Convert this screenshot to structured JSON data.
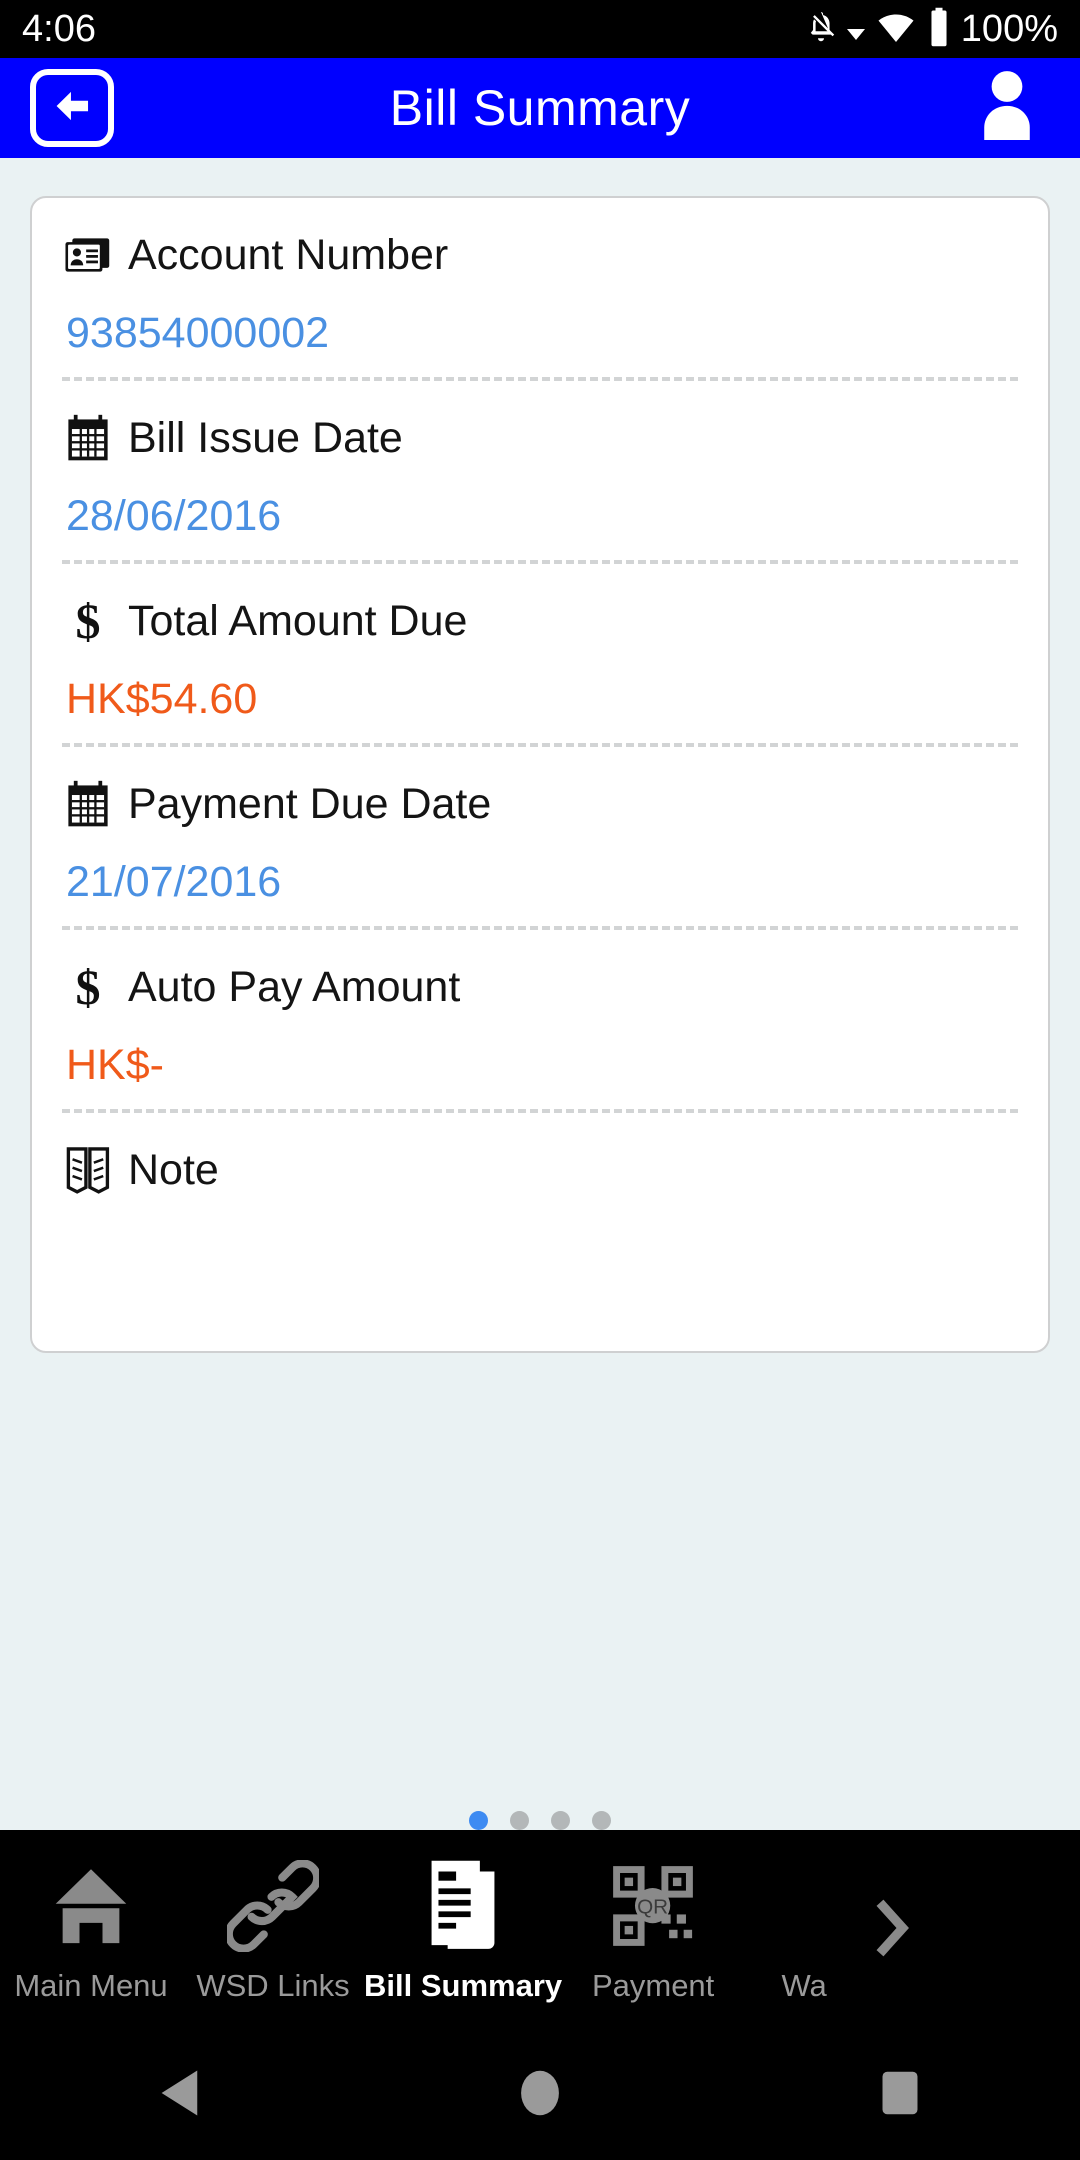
{
  "status_bar": {
    "time": "4:06",
    "battery_percent": "100%",
    "icons": [
      "notifications-off-icon",
      "caret-down-icon",
      "wifi-icon",
      "battery-icon"
    ]
  },
  "app_bar": {
    "title": "Bill Summary",
    "back_icon": "back-arrow-icon",
    "profile_icon": "person-icon"
  },
  "card": {
    "rows": [
      {
        "icon": "id-card-icon",
        "label": "Account Number",
        "value": "93854000002",
        "value_color": "#4a90e2"
      },
      {
        "icon": "calendar-icon",
        "label": "Bill Issue Date",
        "value": "28/06/2016",
        "value_color": "#4a90e2"
      },
      {
        "icon": "dollar-icon",
        "label": "Total Amount Due",
        "value": "HK$54.60",
        "value_color": "#f05a1a"
      },
      {
        "icon": "calendar-icon",
        "label": "Payment Due Date",
        "value": "21/07/2016",
        "value_color": "#4a90e2"
      },
      {
        "icon": "dollar-icon",
        "label": "Auto Pay Amount",
        "value": "HK$-",
        "value_color": "#f05a1a"
      },
      {
        "icon": "book-icon",
        "label": "Note",
        "value": "",
        "value_color": ""
      }
    ]
  },
  "pager": {
    "total_dots": 4,
    "active_index": 0
  },
  "tab_bar": {
    "active_index": 2,
    "tabs": [
      {
        "label": "Main Menu",
        "icon": "home-icon"
      },
      {
        "label": "WSD Links",
        "icon": "link-icon"
      },
      {
        "label": "Bill Summary",
        "icon": "document-icon"
      },
      {
        "label": "Payment",
        "icon": "qr-code-icon"
      },
      {
        "label": "Wa",
        "icon": "partial-icon"
      }
    ],
    "next_arrow_icon": "chevron-right-icon"
  },
  "system_nav": {
    "buttons": [
      {
        "name": "back",
        "icon": "triangle-back-icon"
      },
      {
        "name": "home",
        "icon": "circle-home-icon"
      },
      {
        "name": "recents",
        "icon": "square-recents-icon"
      }
    ]
  },
  "theme": {
    "appbar_blue": "#0000ff",
    "background": "#eaf2f3",
    "value_blue": "#4a90e2",
    "value_orange": "#f05a1a",
    "dot_active": "#3d8bf2"
  }
}
